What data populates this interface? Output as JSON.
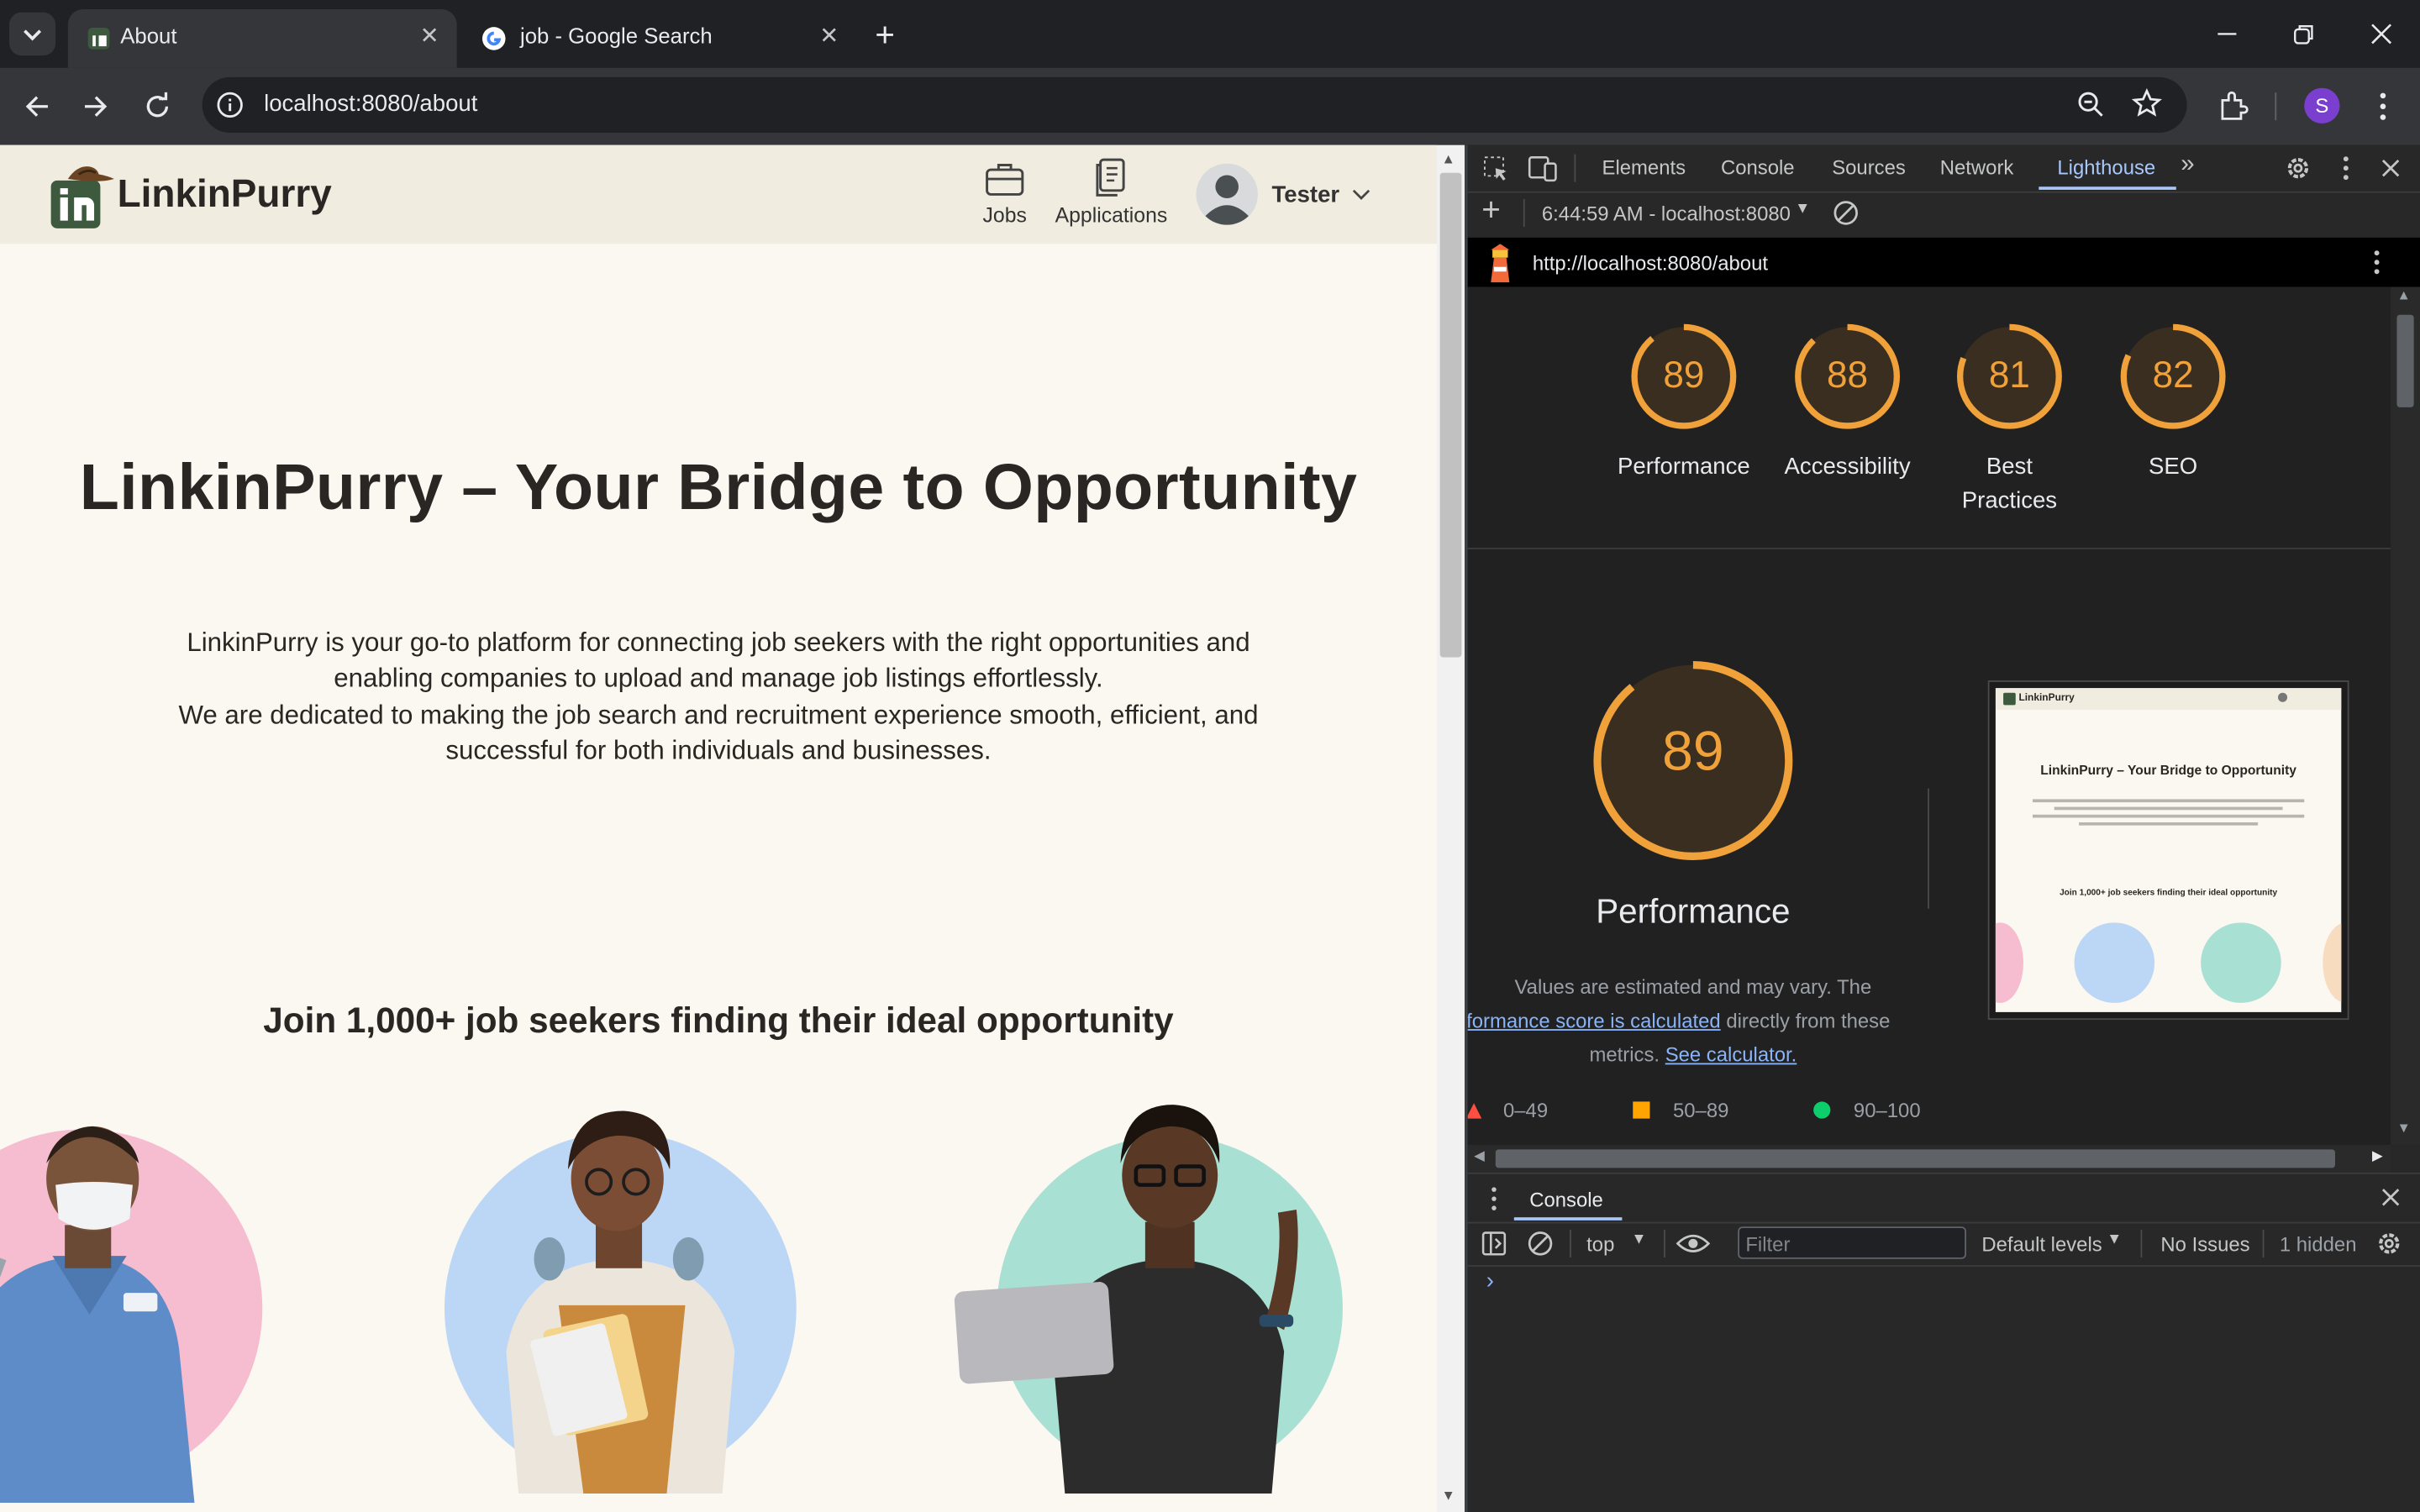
{
  "browser": {
    "tabs": [
      {
        "title": "About",
        "active": true
      },
      {
        "title": "job - Google Search",
        "active": false
      }
    ],
    "url": "localhost:8080/about",
    "profile_initial": "S"
  },
  "site": {
    "brand": "LinkinPurry",
    "nav": [
      {
        "label": "Jobs",
        "icon": "briefcase-icon"
      },
      {
        "label": "Applications",
        "icon": "document-icon"
      }
    ],
    "user": "Tester",
    "hero_title": "LinkinPurry – Your Bridge to Opportunity",
    "hero_lines": [
      "LinkinPurry is your go-to platform for connecting job seekers with the right opportunities and",
      "enabling companies to upload and manage job listings effortlessly.",
      "We are dedicated to making the job search and recruitment experience smooth, efficient, and",
      "successful for both individuals and businesses."
    ],
    "join_heading": "Join 1,000+ job seekers finding their ideal opportunity",
    "colors": {
      "header_bg": "#f1ece0",
      "page_bg": "#fbf7f1",
      "brand_green": "#3d5a3e",
      "text": "#2a2623"
    }
  },
  "devtools": {
    "tabs": [
      "Elements",
      "Console",
      "Sources",
      "Network",
      "Lighthouse"
    ],
    "active_tab": "Lighthouse",
    "report_selector": "6:44:59 AM - localhost:8080",
    "report_url": "http://localhost:8080/about",
    "scores": [
      {
        "label": "Performance",
        "value": 89
      },
      {
        "label": "Accessibility",
        "value": 88
      },
      {
        "label": "Best Practices",
        "value": 81
      },
      {
        "label": "SEO",
        "value": 82
      }
    ],
    "best_practices_lines": [
      "Best",
      "Practices"
    ],
    "perf_title": "Performance",
    "perf_score": 89,
    "perf_note_1": "Values are estimated and may vary. The",
    "perf_note_link": "performance score is calculated",
    "perf_note_2": "directly from these",
    "perf_note_3": "metrics.",
    "calc_link": "See calculator.",
    "legend": [
      {
        "range": "0–49",
        "color": "#ff4e42",
        "shape": "triangle"
      },
      {
        "range": "50–89",
        "color": "#ffa400",
        "shape": "square"
      },
      {
        "range": "90–100",
        "color": "#0cce6b",
        "shape": "circle"
      }
    ],
    "thumbnail": {
      "brand": "LinkinPurry",
      "title": "LinkinPurry – Your Bridge to Opportunity",
      "join": "Join 1,000+ job seekers finding their ideal opportunity"
    },
    "console": {
      "title": "Console",
      "context": "top",
      "filter_placeholder": "Filter",
      "levels": "Default levels",
      "issues": "No Issues",
      "hidden": "1 hidden",
      "prompt": "›"
    },
    "accent": "#a8c7fa",
    "gauge_color": "#f0a13a"
  }
}
